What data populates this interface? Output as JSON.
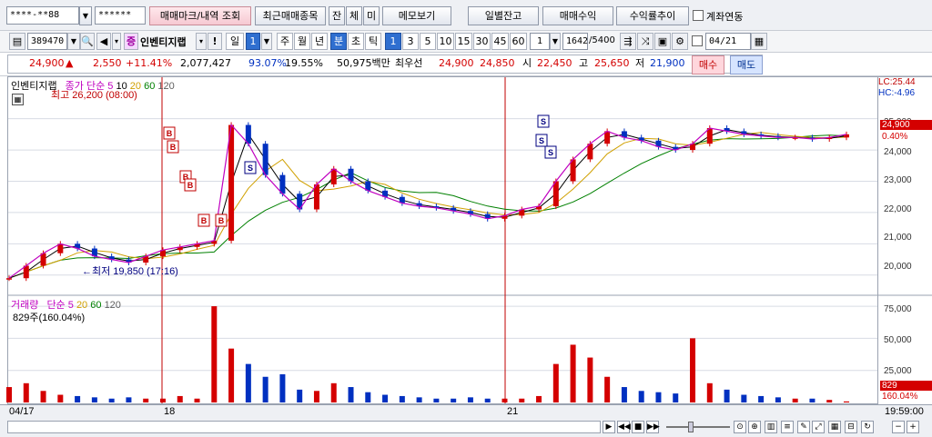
{
  "top": {
    "account": "****-**88",
    "password": "******",
    "btn_marks": "매매마크/내역 조회",
    "btn_recent": "최근매매종목",
    "btn_jan": "잔",
    "btn_che": "체",
    "btn_mi": "미",
    "btn_memo": "메모보기",
    "btn_daily": "일별잔고",
    "btn_profit": "매매수익",
    "btn_trend": "수익률추이",
    "chk_link": "계좌연동"
  },
  "toolbar": {
    "code": "389470",
    "name": "인벤티지랩",
    "period_day": "일",
    "period_day_num": "1",
    "period_week": "주",
    "period_month": "월",
    "period_year": "년",
    "period_min": "분",
    "period_sec": "초",
    "period_tick": "틱",
    "intervals": [
      "1",
      "3",
      "5",
      "10",
      "15",
      "30",
      "45",
      "60"
    ],
    "interval_value": "1",
    "count": "1642",
    "total": "/5400",
    "date": "04/21"
  },
  "quote": {
    "price": "24,900",
    "change": "2,550",
    "change_pct": "+11.41%",
    "volume": "2,077,427",
    "vol_ratio": "93.07%",
    "turnover": "19.55%",
    "amount": "50,975백만",
    "best_label": "최우선",
    "best_ask": "24,900",
    "best_bid": "24,850",
    "open_label": "시",
    "open": "22,450",
    "high_label": "고",
    "high": "25,650",
    "low_label": "저",
    "low": "21,900",
    "buy": "매수",
    "sell": "매도"
  },
  "price_panel": {
    "legend_name": "인벤티지랩",
    "legend_ma": "종가 단순",
    "ma_periods": [
      "5",
      "10",
      "20",
      "60",
      "120"
    ],
    "ma_colors": [
      "#c000c0",
      "#000000",
      "#d0a000",
      "#008000",
      "#606060"
    ],
    "high_note": "최고 26,200 (08:00)",
    "low_note": "←최저 19,850 (17:16)",
    "lc": "LC:25.44",
    "hc": "HC:-4.96",
    "last_price": "24,900",
    "last_pct": "0.40%",
    "yticks": [
      "25,000",
      "24,000",
      "23,000",
      "22,000",
      "21,000",
      "20,000"
    ]
  },
  "volume_panel": {
    "legend_name": "거래량",
    "legend_ma": "단순",
    "ma_periods": [
      "5",
      "20",
      "60",
      "120"
    ],
    "vol_note": "829주(160.04%)",
    "yticks": [
      "75,000",
      "50,000",
      "25,000"
    ],
    "last_vol": "829",
    "last_pct": "160.04%"
  },
  "xaxis": {
    "labels": [
      "04/17",
      "18",
      "21"
    ],
    "time": "19:59:00"
  },
  "colors": {
    "price_up": "#d40000",
    "price_down": "#0030c0",
    "buy_marker": "#c00000",
    "sell_marker": "#000080"
  },
  "markers": {
    "buy_letter": "B",
    "sell_letter": "S"
  },
  "chart_data": {
    "type": "line",
    "title": "",
    "ylabel": "",
    "xlabel": "",
    "x": [
      "04/17",
      "18",
      "21"
    ],
    "price_ylim": [
      19500,
      25600
    ],
    "volume_ylim": [
      0,
      80000
    ],
    "series": [
      {
        "name": "종가",
        "values": [
          19900,
          20300,
          20700,
          21000,
          20850,
          20600,
          20500,
          20400,
          20600,
          20800,
          20900,
          21000,
          21100,
          24800,
          24200,
          23200,
          22600,
          22100,
          22900,
          23400,
          23000,
          22700,
          22500,
          22300,
          22200,
          22150,
          22050,
          21950,
          21800,
          21900,
          22100,
          22200,
          23000,
          23700,
          24200,
          24600,
          24400,
          24300,
          24100,
          24000,
          24200,
          24700,
          24600,
          24500,
          24450,
          24400,
          24400,
          24350,
          24400,
          24500
        ]
      },
      {
        "name": "거래량",
        "values": [
          12000,
          15000,
          9000,
          6000,
          5000,
          4000,
          3000,
          4000,
          3000,
          3000,
          5000,
          3000,
          75000,
          42000,
          30000,
          20000,
          22000,
          10000,
          9000,
          15000,
          12000,
          8000,
          6000,
          5000,
          4000,
          3000,
          3000,
          4000,
          3000,
          3000,
          3000,
          5000,
          30000,
          45000,
          35000,
          20000,
          12000,
          9000,
          8000,
          7000,
          50000,
          15000,
          10000,
          6000,
          5000,
          4000,
          3000,
          3000,
          2000,
          829
        ]
      }
    ],
    "grid": true,
    "legend": "top-left"
  }
}
